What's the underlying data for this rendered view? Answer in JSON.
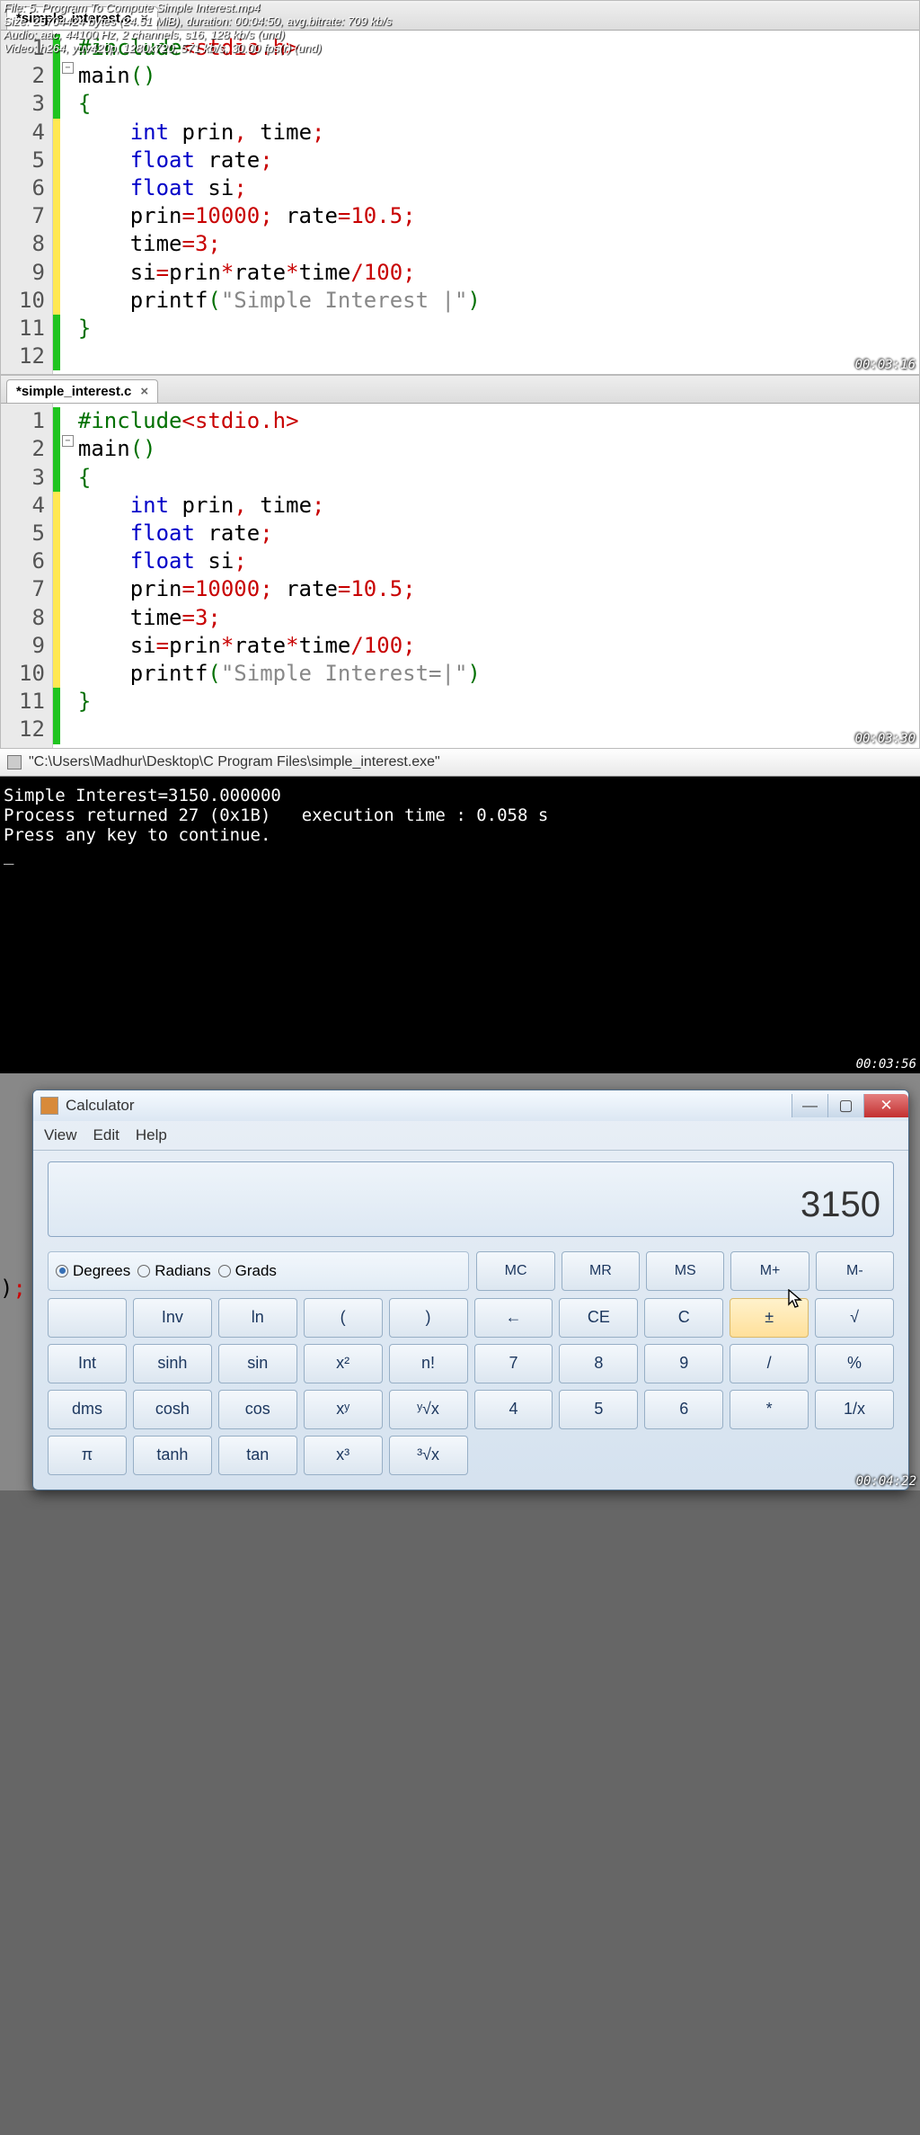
{
  "overlay": {
    "l1": "File: 5. Program To Compute Simple Interest.mp4",
    "l2": "Size: 25704424 bytes (24.51 MiB), duration: 00:04:50, avg.bitrate: 709 kb/s",
    "l3": "Audio: aac, 44100 Hz, 2 channels, s16, 128 kb/s (und)",
    "l4": "Video: h264, yuv420p, 1280x720, 571 kb/s, 30.00 fps(r) (und)"
  },
  "editor": {
    "tab_name": "*simple_interest.c",
    "lines": [
      "1",
      "2",
      "3",
      "4",
      "5",
      "6",
      "7",
      "8",
      "9",
      "10",
      "11",
      "12"
    ]
  },
  "code1_str": "\"Simple Interest |\"",
  "code2_str": "\"Simple Interest=|\"",
  "ts": {
    "s1": "00:03:16",
    "s2": "00:03:30",
    "s3": "00:03:56",
    "s4": "00:04:22"
  },
  "console": {
    "title": "\"C:\\Users\\Madhur\\Desktop\\C Program Files\\simple_interest.exe\"",
    "line1": "Simple Interest=3150.000000",
    "line2": "Process returned 27 (0x1B)   execution time : 0.058 s",
    "line3": "Press any key to continue.",
    "cursor": "_"
  },
  "calc": {
    "title": "Calculator",
    "menu": {
      "view": "View",
      "edit": "Edit",
      "help": "Help"
    },
    "display": "3150",
    "modes": {
      "deg": "Degrees",
      "rad": "Radians",
      "grad": "Grads"
    },
    "btns": {
      "mc": "MC",
      "mr": "MR",
      "ms": "MS",
      "mp": "M+",
      "mm": "M-",
      "empty": "",
      "inv": "Inv",
      "ln": "ln",
      "lp": "(",
      "rp": ")",
      "back": "←",
      "ce": "CE",
      "c": "C",
      "pm": "±",
      "sqrt": "√",
      "int": "Int",
      "sinh": "sinh",
      "sin": "sin",
      "x2": "x²",
      "nfac": "n!",
      "n7": "7",
      "n8": "8",
      "n9": "9",
      "div": "/",
      "pct": "%",
      "dms": "dms",
      "cosh": "cosh",
      "cos": "cos",
      "xy": "xʸ",
      "yroot": "ʸ√x",
      "n4": "4",
      "n5": "5",
      "n6": "6",
      "mul": "*",
      "inv1": "1/x",
      "pi": "π",
      "tanh": "tanh",
      "tan": "tan",
      "x3": "x³",
      "cubrt": "³√x"
    },
    "frag": ");"
  }
}
